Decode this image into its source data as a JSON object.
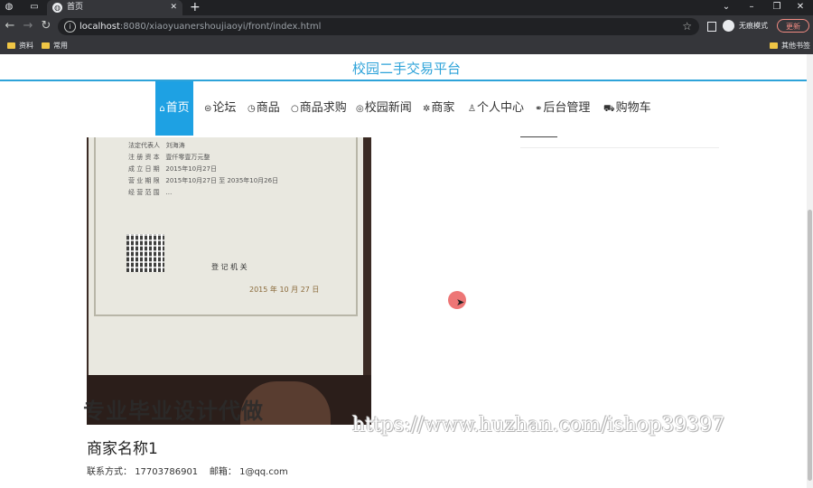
{
  "browser": {
    "tab_title": "首页",
    "url_host": "localhost",
    "url_path": ":8080/xiaoyuanershoujiaoyi/front/index.html",
    "incognito_label": "无痕模式",
    "update_label": "更新",
    "bookmarks": [
      "资料",
      "常用"
    ],
    "other_bookmarks": "其他书签"
  },
  "site": {
    "title": "校园二手交易平台"
  },
  "nav": {
    "items": [
      {
        "label": "首页",
        "icon": "home-icon"
      },
      {
        "label": "论坛",
        "icon": "chat-icon"
      },
      {
        "label": "商品",
        "icon": "clock-icon"
      },
      {
        "label": "商品求购",
        "icon": "circle-icon"
      },
      {
        "label": "校园新闻",
        "icon": "globe-icon"
      },
      {
        "label": "商家",
        "icon": "gear-icon"
      },
      {
        "label": "个人中心",
        "icon": "user-icon"
      },
      {
        "label": "后台管理",
        "icon": "link-icon"
      },
      {
        "label": "购物车",
        "icon": "cart-icon"
      }
    ],
    "active_index": 0
  },
  "merchant": {
    "name": "商家名称1",
    "phone_label": "联系方式：",
    "phone": "17703786901",
    "email_label": "邮箱：",
    "email": "1@qq.com"
  },
  "photo_text": {
    "rows": [
      [
        "法定代表人",
        "刘海涛"
      ],
      [
        "注 册 资 本",
        "壹仟零壹万元整"
      ],
      [
        "成 立 日 期",
        "2015年10月27日"
      ],
      [
        "营 业 期 限",
        "2015年10月27日 至 2035年10月26日"
      ],
      [
        "经 营 范 围",
        "…"
      ]
    ],
    "authority": "登 记 机 关",
    "date": "2015 年 10 月 27 日"
  },
  "overlays": {
    "watermark_left": "专业毕业设计代做",
    "watermark_right": "https://www.huzhan.com/ishop39397"
  },
  "colors": {
    "accent": "#1ea1e3",
    "title": "#2ea3d9"
  }
}
